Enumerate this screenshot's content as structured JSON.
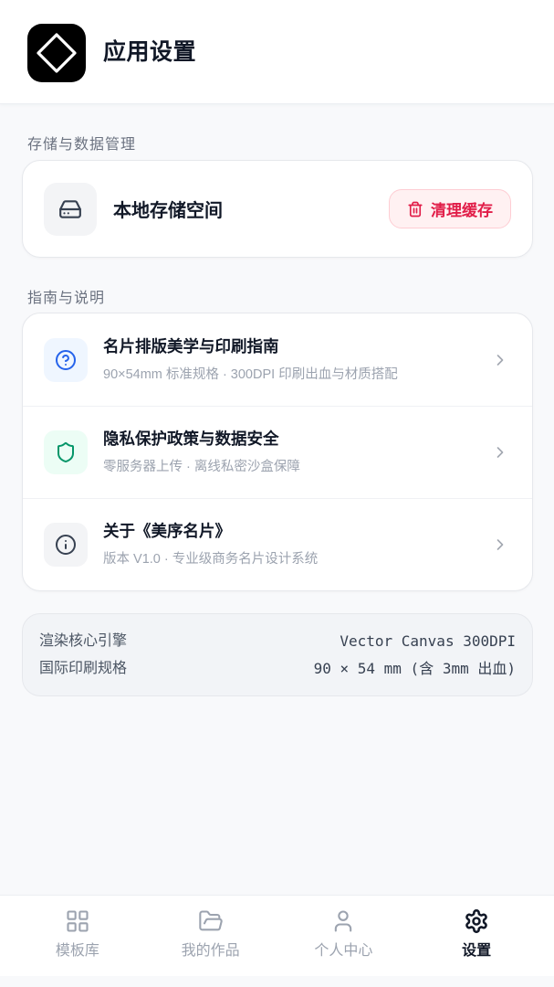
{
  "header": {
    "title": "应用设置",
    "logo_icon": "diamond-logo-icon"
  },
  "storage_section": {
    "label": "存储与数据管理",
    "item": {
      "icon": "hard-drive-icon",
      "label": "本地存储空间",
      "action_icon": "trash-icon",
      "action_label": "清理缓存"
    }
  },
  "guide_section": {
    "label": "指南与说明",
    "items": [
      {
        "icon": "help-circle-icon",
        "icon_color": "#2563eb",
        "icon_bg": "#eff6ff",
        "title": "名片排版美学与印刷指南",
        "subtitle": "90×54mm 标准规格 · 300DPI 印刷出血与材质搭配"
      },
      {
        "icon": "shield-icon",
        "icon_color": "#059669",
        "icon_bg": "#ecfdf5",
        "title": "隐私保护政策与数据安全",
        "subtitle": "零服务器上传 · 离线私密沙盒保障"
      },
      {
        "icon": "info-icon",
        "icon_color": "#374151",
        "icon_bg": "#f3f4f6",
        "title": "关于《美序名片》",
        "subtitle": "版本 V1.0 · 专业级商务名片设计系统"
      }
    ]
  },
  "specs": [
    {
      "label": "渲染核心引擎",
      "value": "Vector Canvas 300DPI"
    },
    {
      "label": "国际印刷规格",
      "value": "90 × 54 mm (含 3mm 出血)"
    }
  ],
  "bottom_nav": {
    "items": [
      {
        "icon": "grid-icon",
        "label": "模板库",
        "active": false
      },
      {
        "icon": "folder-open-icon",
        "label": "我的作品",
        "active": false
      },
      {
        "icon": "user-icon",
        "label": "个人中心",
        "active": false
      },
      {
        "icon": "settings-gear-icon",
        "label": "设置",
        "active": true
      }
    ]
  },
  "colors": {
    "text_primary": "#111827",
    "text_secondary": "#6b7280",
    "text_muted": "#9ca3af",
    "danger": "#e11d48",
    "danger_bg": "#fff1f2",
    "page_bg": "#f8f9fb"
  }
}
